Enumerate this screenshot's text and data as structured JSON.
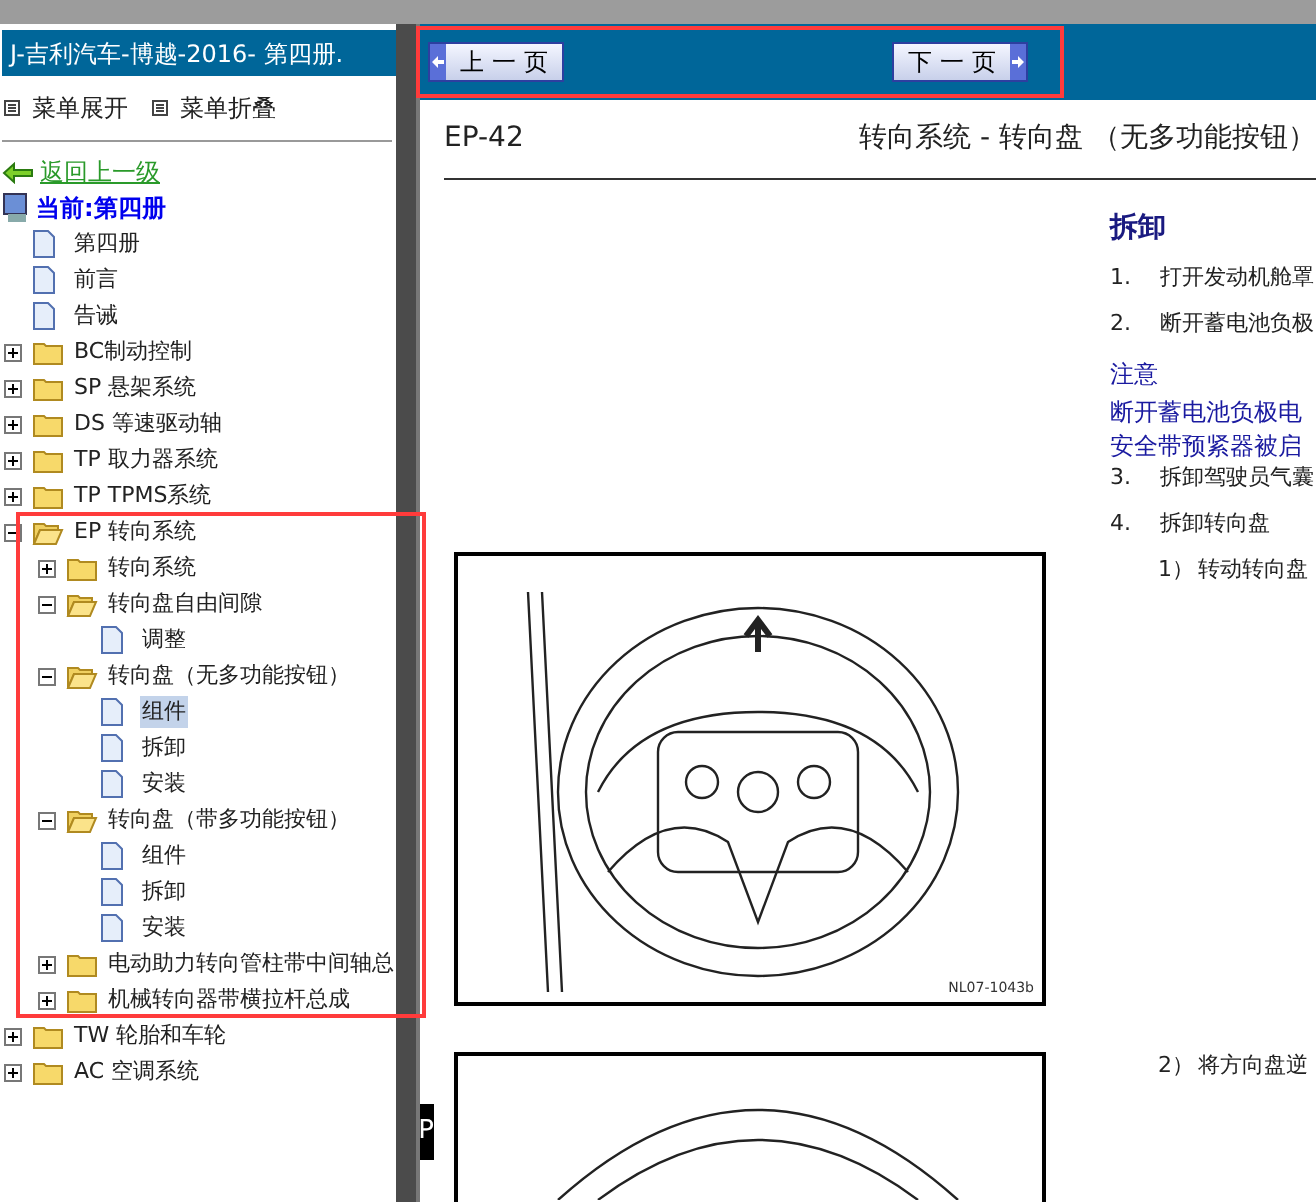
{
  "sidebar": {
    "title": "J-吉利汽车-博越-2016- 第四册.",
    "menu_buttons": [
      "菜单展开",
      "菜单折叠"
    ],
    "back_link": "返回上一级",
    "current": "当前:第四册",
    "tree": [
      {
        "label": "第四册"
      },
      {
        "label": "前言"
      },
      {
        "label": "告诫"
      },
      {
        "label": "BC制动控制",
        "expanded": false
      },
      {
        "label": "SP 悬架系统",
        "expanded": false
      },
      {
        "label": "DS 等速驱动轴",
        "expanded": false
      },
      {
        "label": "TP 取力器系统",
        "expanded": false
      },
      {
        "label": "TP TPMS系统",
        "expanded": false
      },
      {
        "label": "EP 转向系统",
        "expanded": true,
        "children": [
          {
            "label": "转向系统",
            "expanded": false
          },
          {
            "label": "转向盘自由间隙",
            "expanded": true,
            "children": [
              {
                "label": "调整",
                "selected": false
              }
            ]
          },
          {
            "label": "转向盘（无多功能按钮）",
            "expanded": true,
            "children": [
              {
                "label": "组件",
                "selected": true
              },
              {
                "label": "拆卸",
                "selected": false
              },
              {
                "label": "安装",
                "selected": false
              }
            ]
          },
          {
            "label": "转向盘（带多功能按钮）",
            "expanded": true,
            "children": [
              {
                "label": "组件",
                "selected": false
              },
              {
                "label": "拆卸",
                "selected": false
              },
              {
                "label": "安装",
                "selected": false
              }
            ]
          },
          {
            "label": "电动助力转向管柱带中间轴总",
            "expanded": false
          },
          {
            "label": "机械转向器带横拉杆总成",
            "expanded": false
          }
        ]
      },
      {
        "label": "TW 轮胎和车轮",
        "expanded": false
      },
      {
        "label": "AC 空调系统",
        "expanded": false
      }
    ]
  },
  "nav": {
    "prev": "上 一 页",
    "next": "下 一 页"
  },
  "page": {
    "code": "EP-42",
    "title": "转向系统 - 转向盘 （无多功能按钮）",
    "side_tab": "P",
    "section": "拆卸",
    "steps": [
      {
        "kind": "step",
        "num": "1.",
        "text": "打开发动机舱罩"
      },
      {
        "kind": "step",
        "num": "2.",
        "text": "断开蓄电池负极"
      },
      {
        "kind": "note_title",
        "text": "注意"
      },
      {
        "kind": "note",
        "text": "断开蓄电池负极电"
      },
      {
        "kind": "note",
        "text": "安全带预紧器被启"
      },
      {
        "kind": "step",
        "num": "3.",
        "text": "拆卸驾驶员气囊"
      },
      {
        "kind": "step",
        "num": "4.",
        "text": "拆卸转向盘"
      },
      {
        "kind": "substep",
        "num": "1）",
        "text": "转动转向盘"
      }
    ],
    "figure_caption": "NL07-1043b",
    "later_step": {
      "num": "2）",
      "text": "将方向盘逆"
    }
  }
}
